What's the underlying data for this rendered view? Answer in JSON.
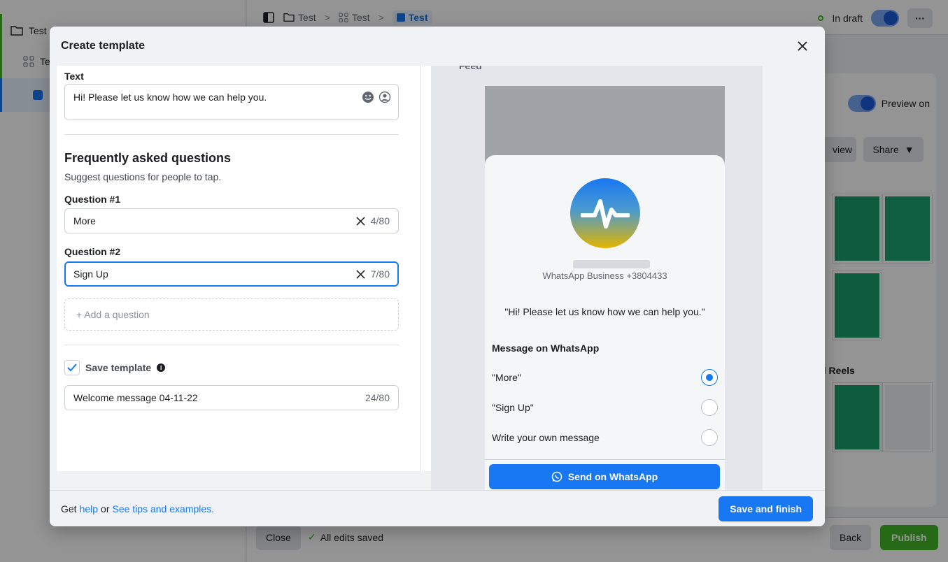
{
  "background": {
    "sidebar": {
      "item1": "Test",
      "item2": "Te"
    },
    "breadcrumb": [
      "Test",
      "Test",
      "Test"
    ],
    "status": "In draft",
    "preview_label": "Preview on",
    "view_btn": "view",
    "share_btn": "Share",
    "reels_label": "d Reels",
    "close_btn": "Close",
    "saved_text": "All edits saved",
    "back_btn": "Back",
    "publish_btn": "Publish"
  },
  "modal": {
    "title": "Create template",
    "text_label": "Text",
    "text_value": "Hi! Please let us know how we can help you.",
    "faq_title": "Frequently asked questions",
    "faq_sub": "Suggest questions for people to tap.",
    "questions": [
      {
        "label": "Question #1",
        "value": "More",
        "count": "4/80"
      },
      {
        "label": "Question #2",
        "value": "Sign Up",
        "count": "7/80"
      }
    ],
    "add_question": "+ Add a question",
    "save_template_label": "Save template",
    "template_name": "Welcome message 04-11-22",
    "template_count": "24/80",
    "footer": {
      "get": "Get",
      "help": "help",
      "or": "or",
      "tips": "See tips and examples."
    },
    "save_finish": "Save and finish"
  },
  "preview": {
    "feed_label": "Feed",
    "business_number": "WhatsApp Business +3804433",
    "greeting": "\"Hi! Please let us know how we can help you.\"",
    "message_title": "Message on WhatsApp",
    "options": [
      "\"More\"",
      "\"Sign Up\"",
      "Write your own message"
    ],
    "send_btn": "Send on WhatsApp"
  },
  "colors": {
    "accent": "#1877f2",
    "success": "#42b72a"
  }
}
